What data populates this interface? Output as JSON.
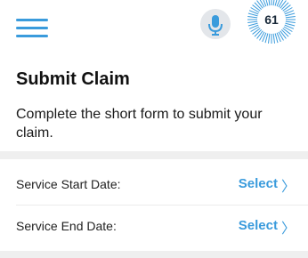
{
  "header": {
    "menu_icon": "hamburger-menu-icon",
    "mic_icon": "microphone-icon",
    "badge_value": "61",
    "accent_color": "#3a9bdc"
  },
  "main": {
    "title": "Submit Claim",
    "description": "Complete the short form to submit your claim."
  },
  "form": {
    "rows": [
      {
        "label": "Service Start Date:",
        "action": "Select",
        "chevron": "〉"
      },
      {
        "label": "Service End Date:",
        "action": "Select",
        "chevron": "〉"
      }
    ]
  }
}
